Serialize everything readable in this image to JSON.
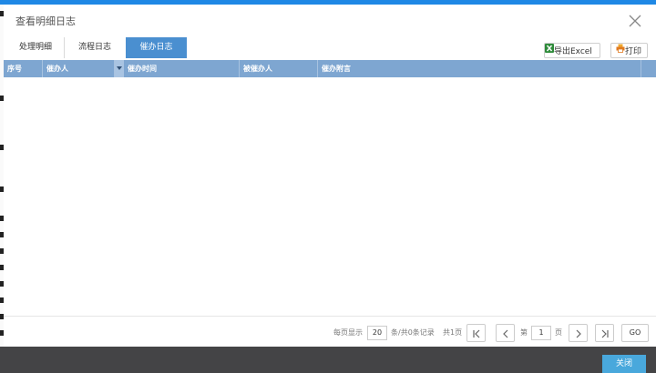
{
  "dialog": {
    "title": "查看明细日志"
  },
  "tabs": [
    {
      "label": "处理明细"
    },
    {
      "label": "流程日志"
    },
    {
      "label": "催办日志"
    }
  ],
  "toolbar": {
    "export_label": "导出Excel",
    "print_label": "打印"
  },
  "grid": {
    "columns": [
      "序号",
      "催办人",
      "催办时间",
      "被催办人",
      "催办附言"
    ],
    "rows": []
  },
  "pager": {
    "per_page_label": "每页显示",
    "page_size": "20",
    "total_label": "条/共0条记录",
    "pages_label": "共1页",
    "page_prefix": "第",
    "current_page": "1",
    "page_suffix": "页",
    "go_label": "GO"
  },
  "footer": {
    "close_label": "关闭"
  },
  "colors": {
    "accent": "#1f88e5",
    "active_tab": "#4a8fd0",
    "grid_header": "#7ea6d1",
    "footer_bg": "#444446",
    "close_button": "#49a8dc"
  },
  "icons": [
    "close-icon",
    "excel-icon",
    "printer-icon",
    "sort-down-icon",
    "first-page-icon",
    "prev-page-icon",
    "next-page-icon",
    "last-page-icon"
  ]
}
